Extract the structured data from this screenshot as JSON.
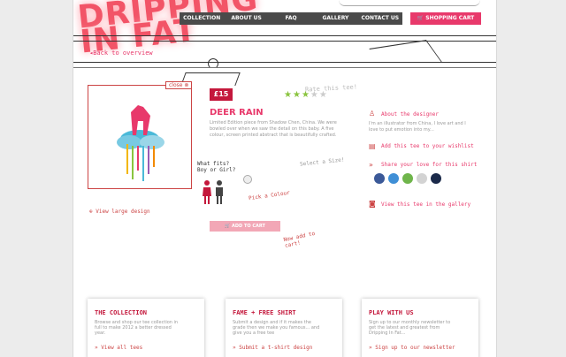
{
  "brand": {
    "logo_line1": "DRIPPING",
    "logo_line2": "IN FAT"
  },
  "nav": {
    "items": [
      "COLLECTION",
      "ABOUT US",
      "FAQ",
      "GALLERY",
      "CONTACT US"
    ],
    "cart_label": "SHOPPING CART"
  },
  "back_link": "Back to overview",
  "product": {
    "close_label": "close",
    "price": "£15",
    "rate_label": "Rate this tee!",
    "rating": 3,
    "rating_max": 5,
    "title": "DEER RAIN",
    "description": "Limited Edition piece from Shadow Chen, China. We were bowled over when we saw the detail on this baby. A five colour, screen printed abstract that is beautifully crafted.",
    "fit_label": "What fits?",
    "gender_label": "Boy or Girl?",
    "select_size": "Select a Size!",
    "pick_colour": "Pick a Colour",
    "large_design": "View large design",
    "add_to_cart": "ADD TO CART",
    "now_add": "Now add to cart!"
  },
  "designer": {
    "about_label": "About the designer",
    "about_text": "I'm an illustrator from China, I love art and I love to put emotion into my..."
  },
  "actions": {
    "wishlist": "Add this tee to your wishlist",
    "share": "Share your love for this shirt",
    "gallery": "View this tee in the gallery"
  },
  "share_icons": [
    "facebook-icon",
    "delicious-icon",
    "digg-icon",
    "stumble-icon",
    "other-icon"
  ],
  "boxes": [
    {
      "heading": "THE COLLECTION",
      "text": "Browse and shop our tee collection in full to make 2012 a better dressed year.",
      "link": "View all tees"
    },
    {
      "heading": "FAME + FREE SHIRT",
      "text": "Submit a design and if it makes the grade then we make you famous... and give you a free tee",
      "link": "Submit a t-shirt design"
    },
    {
      "heading": "PLAY WITH US",
      "text": "Sign up to our monthly newsletter to get the latest and greatest from Dripping In Fat...",
      "link": "Sign up to our newsletter"
    }
  ],
  "colors": {
    "accent": "#e8396b",
    "price": "#c4183c",
    "star": "#8ac43f",
    "nav": "#4a4a4a"
  }
}
